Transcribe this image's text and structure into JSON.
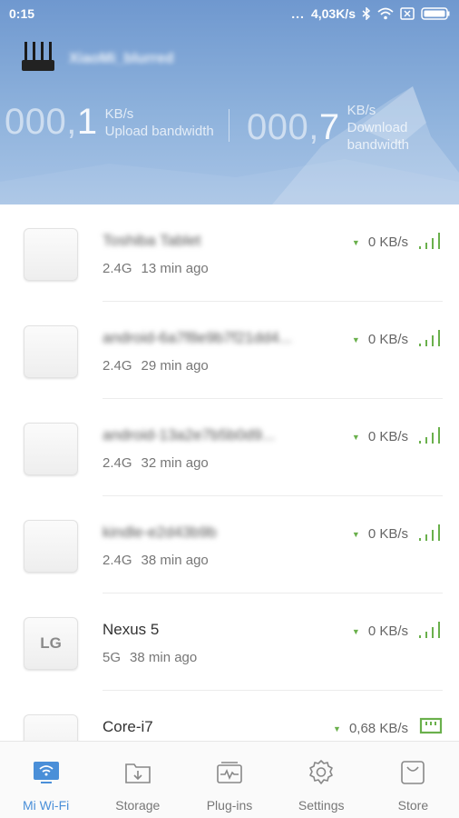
{
  "status_bar": {
    "time": "0:15",
    "dots": "...",
    "speed": "4,03K/s"
  },
  "router": {
    "name": "XiaoMi_blurred"
  },
  "bandwidth": {
    "upload_prefix": "000,",
    "upload_digit": "1",
    "upload_unit": "KB/s",
    "upload_label": "Upload bandwidth",
    "download_prefix": "000,",
    "download_digit": "7",
    "download_unit": "KB/s",
    "download_label_1": "Download",
    "download_label_2": "bandwidth"
  },
  "devices": [
    {
      "name": "Toshiba Tablet",
      "blurred": true,
      "band": "2.4G",
      "time": "13 min ago",
      "rate": "0 KB/s",
      "icon_text": "",
      "connection": "wifi"
    },
    {
      "name": "android-6a7f8e9b7f21dd4...",
      "blurred": true,
      "band": "2.4G",
      "time": "29 min ago",
      "rate": "0 KB/s",
      "icon_text": "",
      "connection": "wifi"
    },
    {
      "name": "android-13a2e7b5b0d9...",
      "blurred": true,
      "band": "2.4G",
      "time": "32 min ago",
      "rate": "0 KB/s",
      "icon_text": "",
      "connection": "wifi"
    },
    {
      "name": "kindle-e2d43b9b",
      "blurred": true,
      "band": "2.4G",
      "time": "38 min ago",
      "rate": "0 KB/s",
      "icon_text": "",
      "connection": "wifi"
    },
    {
      "name": "Nexus 5",
      "blurred": false,
      "band": "5G",
      "time": "38 min ago",
      "rate": "0 KB/s",
      "icon_text": "LG",
      "connection": "wifi"
    },
    {
      "name": "Core-i7",
      "blurred": false,
      "band": "",
      "time": "",
      "rate": "0,68 KB/s",
      "icon_text": "",
      "connection": "ethernet"
    }
  ],
  "nav": {
    "items": [
      {
        "label": "Mi Wi-Fi",
        "icon": "wifi-monitor-icon",
        "active": true
      },
      {
        "label": "Storage",
        "icon": "storage-download-icon",
        "active": false
      },
      {
        "label": "Plug-ins",
        "icon": "plugins-pulse-icon",
        "active": false
      },
      {
        "label": "Settings",
        "icon": "gear-icon",
        "active": false
      },
      {
        "label": "Store",
        "icon": "store-bag-icon",
        "active": false
      }
    ]
  },
  "colors": {
    "header_top": "#6f98cf",
    "signal_green": "#6ab04c",
    "active_blue": "#4a8fd8"
  }
}
